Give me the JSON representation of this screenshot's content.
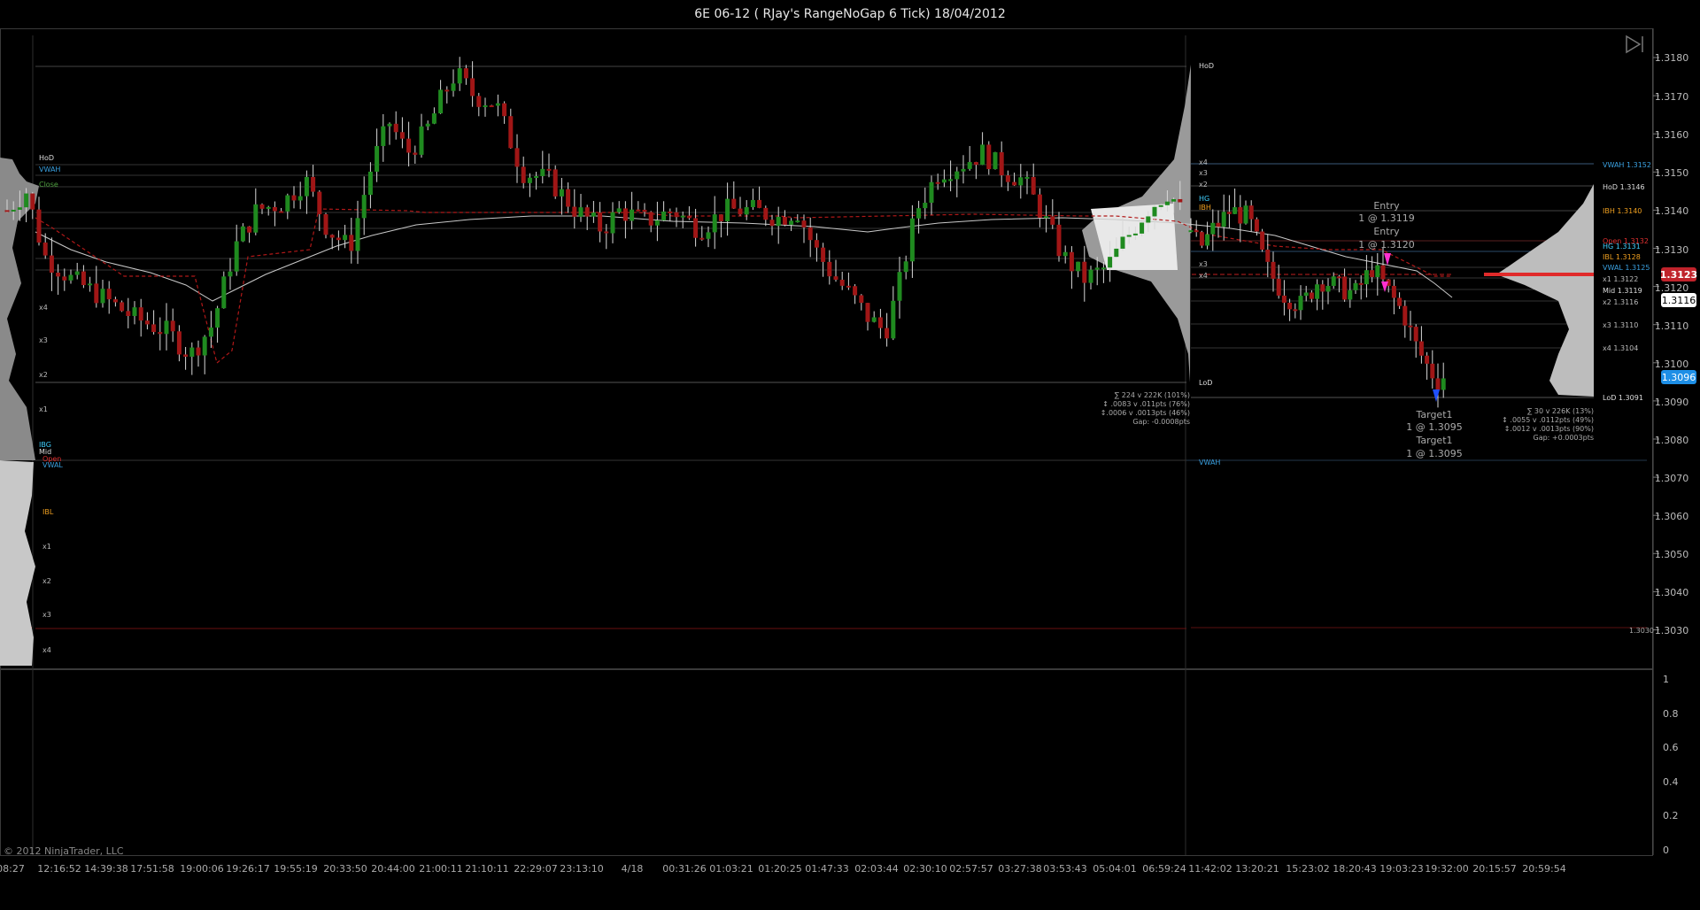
{
  "window": {
    "title": "6E 06-12 ( RJay's RangeNoGap  6 Tick)  18/04/2012"
  },
  "colors": {
    "background": "#000000",
    "grid": "#2a2a2a",
    "up_candle": "#1f8a1f",
    "down_candle": "#a01616",
    "wick": "#d8d8d8",
    "profile": "#bdbdbd",
    "last_price": "#c0232b",
    "bid_price": "#1e8fe6",
    "vwap": "#cfcfcf",
    "ib_high": "#3fd0ff",
    "ib_low": "#f0a020"
  },
  "price_axis": {
    "labels": [
      "1.3180",
      "1.3170",
      "1.3160",
      "1.3150",
      "1.3140",
      "1.3130",
      "1.3120",
      "1.3110",
      "1.3100",
      "1.3090",
      "1.3080",
      "1.3070",
      "1.3060",
      "1.3050",
      "1.3040",
      "1.3030"
    ],
    "last_price": "1.3123",
    "current_price": "1.3116",
    "bid_price": "1.3096",
    "line_label_1030": "1.3030"
  },
  "indicator_axis": {
    "labels": [
      "1",
      "0.8",
      "0.6",
      "0.4",
      "0.2",
      "0"
    ]
  },
  "time_axis": {
    "labels": [
      "08:27",
      "12:16:52",
      "14:39:38",
      "17:51:58",
      "19:00:06",
      "19:26:17",
      "19:55:19",
      "20:33:50",
      "20:44:00",
      "21:00:11",
      "21:10:11",
      "22:29:07",
      "23:13:10",
      "4/18",
      "00:31:26",
      "01:03:21",
      "01:20:25",
      "01:47:33",
      "02:03:44",
      "02:30:10",
      "02:57:57",
      "03:27:38",
      "03:53:43",
      "05:04:01",
      "06:59:24",
      "11:42:02",
      "13:20:21",
      "15:23:02",
      "18:20:43",
      "19:03:23",
      "19:32:00",
      "20:15:57",
      "20:59:54"
    ]
  },
  "left_profile_labels": {
    "hod": "HoD",
    "vwah": "VWAH",
    "close": "Close",
    "x4a": "x4",
    "x3a": "x3",
    "x2a": "x2",
    "x1a": "x1",
    "ibg": "IBG",
    "mid": "Mid",
    "open": "Open",
    "vwal": "VWAL",
    "ibl": "IBL",
    "x1b": "x1",
    "x2b": "x2",
    "x3b": "x3",
    "x4b": "x4"
  },
  "mid_profile_labels": {
    "hod": "HoD",
    "x4": "x4",
    "x3": "x3",
    "x2": "x2",
    "hg": "HG",
    "ibh": "IBH",
    "x3b": "x3",
    "x4b": "x4",
    "lod": "LoD",
    "vwah": "VWAH",
    "stats_1": "∑ 224 v 222K (101%)",
    "stats_2": "↕ .0083 v .011pts (76%)",
    "stats_3": "↕.0006 v .0013pts (46%)",
    "stats_4": "Gap: -0.0008pts"
  },
  "right_profile_labels": {
    "vwah": "VWAH 1.3152",
    "hod": "HoD 1.3146",
    "ibh": "IBH 1.3140",
    "open": "Open 1.3132",
    "hg": "HG 1.3131",
    "ibl": "IBL 1.3128",
    "vwal": "VWAL 1.3125",
    "x1": "x1 1.3122",
    "mid": "Mid 1.3119",
    "x2": "x2 1.3116",
    "x3": "x3 1.3110",
    "x4": "x4 1.3104",
    "lod": "LoD 1.3091",
    "stats_1": "∑ 30 v 226K (13%)",
    "stats_2": "↕ .0055 v .0112pts (49%)",
    "stats_3": "↕.0012 v .0013pts (90%)",
    "stats_4": "Gap: +0.0003pts"
  },
  "trade_markers": {
    "entry_1_label": "Entry",
    "entry_1_fill": "1 @ 1.3119",
    "entry_2_label": "Entry",
    "entry_2_fill": "1 @ 1.3120",
    "target_1_label": "Target1",
    "target_1_fill": "1 @ 1.3095",
    "target_2_label": "Target1",
    "target_2_fill": "1 @ 1.3095"
  },
  "footer": {
    "copyright": "© 2012 NinjaTrader, LLC"
  },
  "icons": {
    "scroll_end": "skip-to-end-icon"
  }
}
